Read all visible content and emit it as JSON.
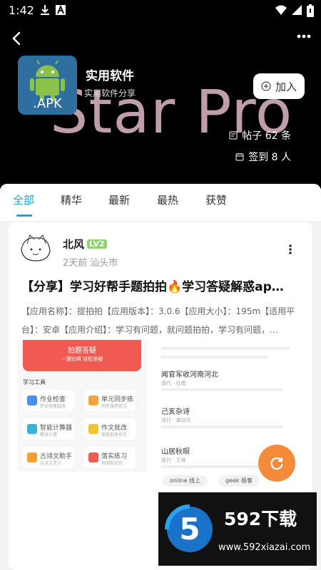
{
  "status_bar": {
    "time": "1:42"
  },
  "header": {
    "bg_text": "Star Pro",
    "app_icon_label": ".APK",
    "circle_name": "实用软件",
    "circle_sub": "实用软件分享",
    "join_label": "加入",
    "posts_stat": "帖子 62 条",
    "checkin_stat": "签到 8 人"
  },
  "tabs": [
    {
      "label": "全部",
      "active": true
    },
    {
      "label": "精华"
    },
    {
      "label": "最新"
    },
    {
      "label": "最热"
    },
    {
      "label": "获赞"
    }
  ],
  "post": {
    "author": "北风",
    "level": "LV2",
    "meta": "2天前 汕头市",
    "title": "【分享】学习好帮手题拍拍🔥学习答疑解惑ap…",
    "body": "【应用名称】：提拍拍【应用版本】：3.0.6【应用大小】：195m【适用平台】：安卓【应用介绍】：学习有问题，就问题拍拍，学习有问题，…",
    "left_screenshot": {
      "banner_title": "拍题答疑",
      "banner_sub": "一键拍照  轻松答疑",
      "section": "学习工具",
      "tools": [
        {
          "name": "作业检查",
          "sub": "作业快速批改"
        },
        {
          "name": "单元同步练",
          "sub": "同步课堂练习"
        },
        {
          "name": "智能计算器",
          "sub": "精准计算"
        },
        {
          "name": "作文批改",
          "sub": "智能批改作文"
        },
        {
          "name": "古诗文助手",
          "sub": "古诗文学习"
        },
        {
          "name": "落实练习",
          "sub": "巩固知识点"
        }
      ]
    },
    "right_screenshot": {
      "poems": [
        {
          "title": "闻官军收河南河北",
          "author": "唐代 · 杜甫"
        },
        {
          "title": "己亥杂诗",
          "author": "清代 · 龚自珍"
        },
        {
          "title": "山居秋暝",
          "author": "唐代 · 王维"
        }
      ],
      "chips": [
        "online 线上",
        "geek 极客"
      ]
    }
  },
  "watermark": {
    "brand": "592下载",
    "url": "www.592xiazai.com",
    "logo_digit": "5"
  }
}
